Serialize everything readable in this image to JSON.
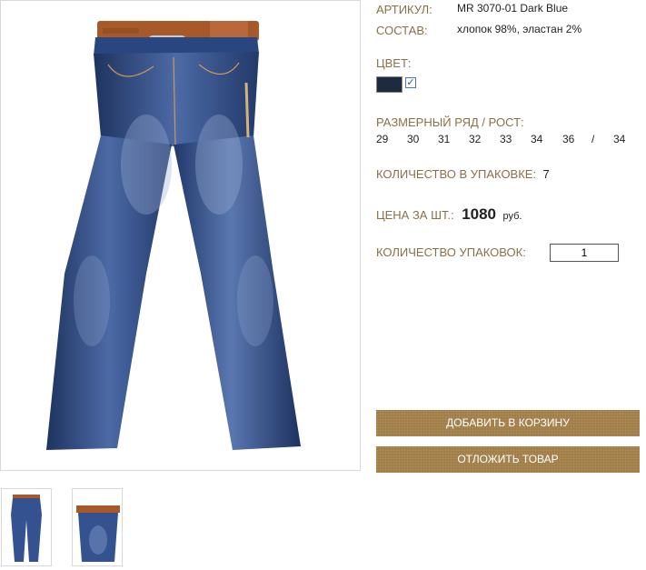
{
  "product": {
    "article_label": "АРТИКУЛ:",
    "article_value": "MR 3070-01 Dark Blue",
    "composition_label": "СОСТАВ:",
    "composition_value": "хлопок 98%, эластан 2%",
    "color_label": "ЦВЕТ:",
    "color_swatch": "#1d2a40",
    "color_checked": "✓",
    "sizes_label": "РАЗМЕРНЫЙ РЯД / РОСТ:",
    "sizes": [
      "29",
      "30",
      "31",
      "32",
      "33",
      "34",
      "36",
      "/",
      "34"
    ],
    "pack_label": "КОЛИЧЕСТВО В УПАКОВКЕ:",
    "pack_value": "7",
    "price_label": "ЦЕНА ЗА ШТ.:",
    "price_value": "1080",
    "price_currency": "руб.",
    "qty_label": "КОЛИЧЕСТВО УПАКОВОК:",
    "qty_value": "1"
  },
  "buttons": {
    "add_to_cart": "ДОБАВИТЬ В КОРЗИНУ",
    "defer": "ОТЛОЖИТЬ ТОВАР"
  },
  "colors": {
    "label_color": "#8b6f47",
    "button_color": "#9c7b47",
    "denim": "#2c4a86"
  }
}
